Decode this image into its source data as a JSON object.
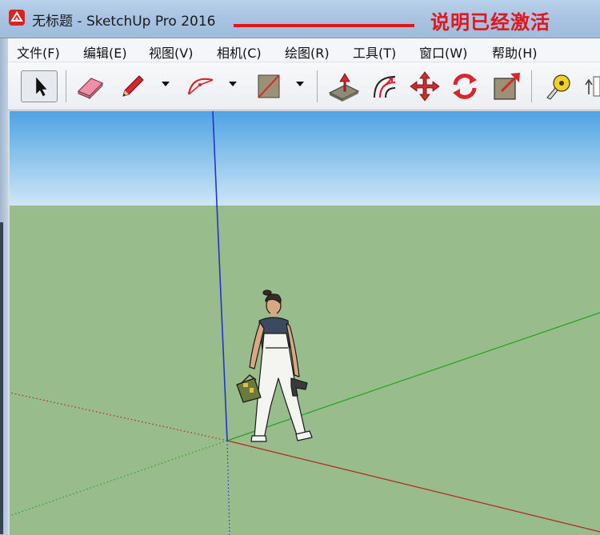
{
  "window": {
    "title": "无标题 - SketchUp Pro 2016",
    "icon": "sketchup-logo-icon"
  },
  "overlay_note": "说明已经激活",
  "menu": {
    "items": [
      {
        "label": "文件(F)"
      },
      {
        "label": "编辑(E)"
      },
      {
        "label": "视图(V)"
      },
      {
        "label": "相机(C)"
      },
      {
        "label": "绘图(R)"
      },
      {
        "label": "工具(T)"
      },
      {
        "label": "窗口(W)"
      },
      {
        "label": "帮助(H)"
      }
    ]
  },
  "toolbar": {
    "tools": [
      {
        "name": "select",
        "icon": "arrow-cursor-icon",
        "active": true
      },
      {
        "name": "eraser",
        "icon": "eraser-icon"
      },
      {
        "name": "line",
        "icon": "pencil-icon",
        "has_dropdown": true
      },
      {
        "name": "arc",
        "icon": "arc-icon",
        "has_dropdown": true
      },
      {
        "name": "rectangle",
        "icon": "rectangle-icon",
        "has_dropdown": true
      },
      {
        "name": "push-pull",
        "icon": "push-pull-icon"
      },
      {
        "name": "offset",
        "icon": "offset-icon"
      },
      {
        "name": "move",
        "icon": "move-icon"
      },
      {
        "name": "rotate",
        "icon": "rotate-icon"
      },
      {
        "name": "scale",
        "icon": "scale-icon"
      },
      {
        "name": "tape-measure",
        "icon": "tape-measure-icon"
      }
    ]
  },
  "viewport": {
    "sky_top": "#4fa3e3",
    "sky_bottom": "#cfe6f6",
    "ground": "#98bc8c",
    "axis_colors": {
      "red": "#b3261e",
      "green": "#1fa51f",
      "blue": "#2233cc"
    },
    "figure": "scale-figure-person"
  }
}
